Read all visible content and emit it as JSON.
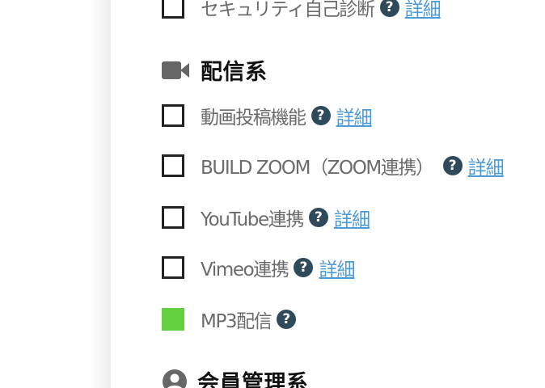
{
  "top_item": {
    "label": "セキュリティ自己診断",
    "help": "?",
    "detail": "詳細"
  },
  "sections": {
    "streaming": {
      "title": "配信系",
      "icon": "video-camera-icon"
    },
    "member": {
      "title": "会員管理系",
      "icon": "user-circle-icon"
    }
  },
  "items": [
    {
      "label": "動画投稿機能",
      "checked": false,
      "help": "?",
      "detail": "詳細"
    },
    {
      "label": "BUILD ZOOM（ZOOM連携）",
      "checked": false,
      "help": "?",
      "detail": "詳細"
    },
    {
      "label": "YouTube連携",
      "checked": false,
      "help": "?",
      "detail": "詳細"
    },
    {
      "label": "Vimeo連携",
      "checked": false,
      "help": "?",
      "detail": "詳細"
    },
    {
      "label": "MP3配信",
      "checked": true,
      "help": "?"
    }
  ],
  "colors": {
    "checked": "#64cf3f",
    "help_icon": "#2f4a5a",
    "link": "#4d9bd6"
  }
}
